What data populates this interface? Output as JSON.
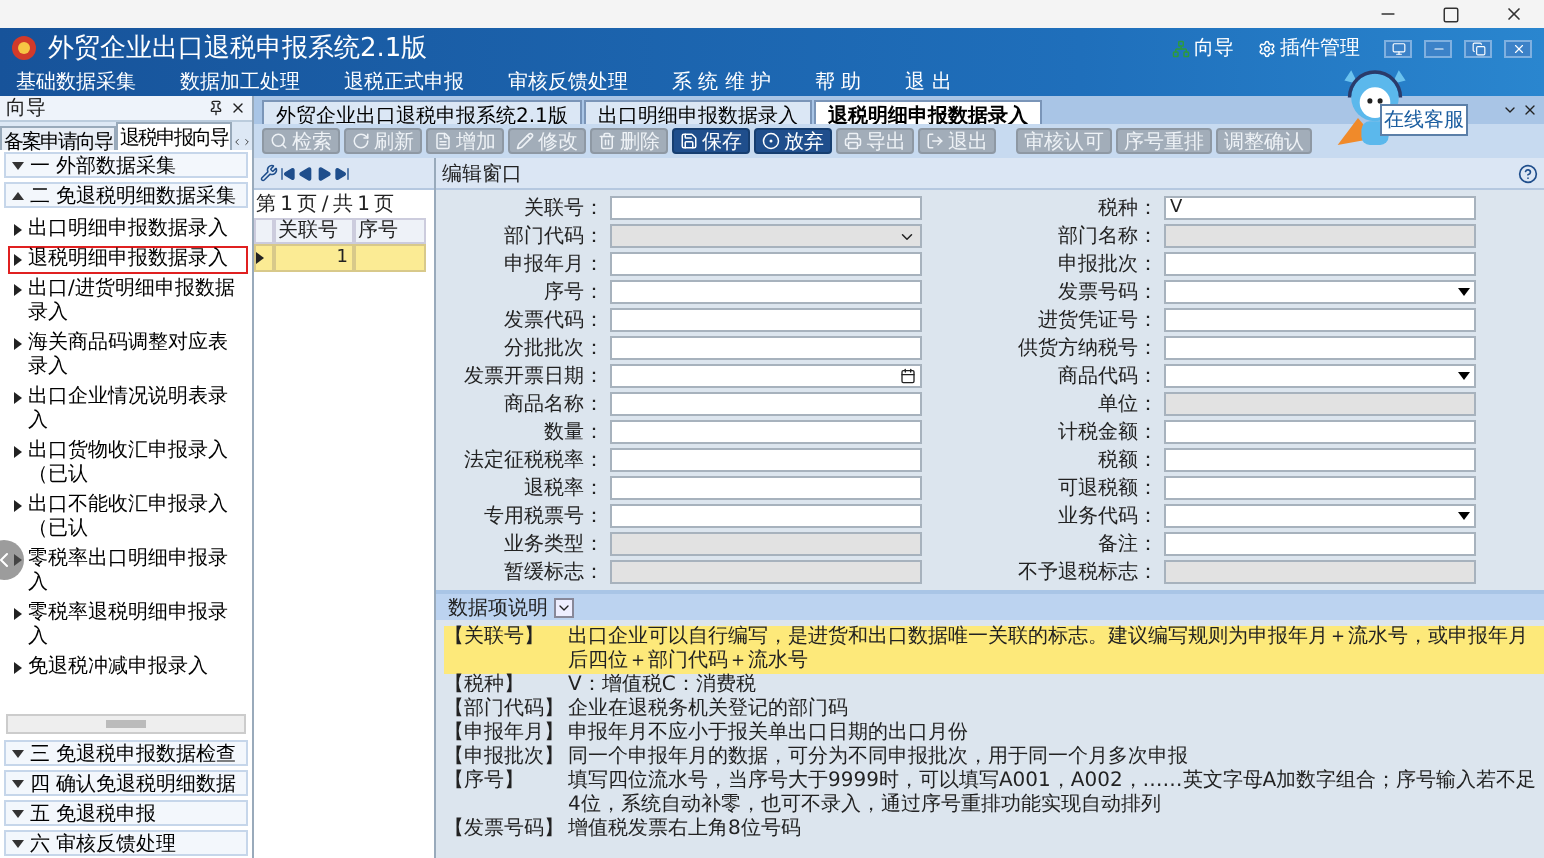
{
  "app": {
    "title": "外贸企业出口退税申报系统2.1版",
    "header_links": [
      "向导",
      "插件管理"
    ],
    "assistant_label": "在线客服"
  },
  "menu": [
    "基础数据采集",
    "数据加工处理",
    "退税正式申报",
    "审核反馈处理",
    "系 统 维 护",
    "帮 助",
    "退 出"
  ],
  "navigator": {
    "title": "向导",
    "tabs": [
      {
        "label": "备案申请向导",
        "selected": false
      },
      {
        "label": "退税申报向导",
        "selected": true
      }
    ],
    "sections": [
      {
        "label": "一 外部数据采集",
        "expanded": false
      },
      {
        "label": "二 免退税明细数据采集",
        "expanded": true,
        "items": [
          {
            "label": "出口明细申报数据录入",
            "selected": false
          },
          {
            "label": "退税明细申报数据录入",
            "selected": true
          },
          {
            "label": "出口/进货明细申报数据录入",
            "selected": false
          },
          {
            "label": "海关商品码调整对应表录入",
            "selected": false
          },
          {
            "label": "出口企业情况说明表录入",
            "selected": false
          },
          {
            "label": "出口货物收汇申报录入（已认",
            "selected": false
          },
          {
            "label": "出口不能收汇申报录入（已认",
            "selected": false
          },
          {
            "label": "零税率出口明细申报录入",
            "selected": false
          },
          {
            "label": "零税率退税明细申报录入",
            "selected": false
          },
          {
            "label": "免退税冲减申报录入",
            "selected": false
          }
        ]
      },
      {
        "label": "三 免退税申报数据检查",
        "expanded": false
      },
      {
        "label": "四 确认免退税明细数据",
        "expanded": false
      },
      {
        "label": "五 免退税申报",
        "expanded": false
      },
      {
        "label": "六 审核反馈处理",
        "expanded": false
      }
    ]
  },
  "tabs": [
    {
      "label": "外贸企业出口退税申报系统2.1版",
      "selected": false
    },
    {
      "label": "出口明细申报数据录入",
      "selected": false
    },
    {
      "label": "退税明细申报数据录入",
      "selected": true
    }
  ],
  "toolbar": [
    {
      "label": "检索",
      "kind": "search",
      "disabled": true
    },
    {
      "label": "刷新",
      "kind": "refresh",
      "disabled": true
    },
    {
      "label": "增加",
      "kind": "add",
      "disabled": true
    },
    {
      "label": "修改",
      "kind": "edit",
      "disabled": true
    },
    {
      "label": "删除",
      "kind": "delete",
      "disabled": true
    },
    {
      "label": "保存",
      "kind": "save",
      "disabled": false
    },
    {
      "label": "放弃",
      "kind": "discard",
      "disabled": false
    },
    {
      "label": "导出",
      "kind": "export",
      "disabled": true
    },
    {
      "label": "退出",
      "kind": "exit",
      "disabled": true
    },
    {
      "label": "审核认可",
      "kind": "plain",
      "disabled": true
    },
    {
      "label": "序号重排",
      "kind": "plain",
      "disabled": true
    },
    {
      "label": "调整确认",
      "kind": "plain",
      "disabled": true
    }
  ],
  "grid": {
    "pager": "第 1 页 / 共 1 页",
    "columns": [
      "关联号",
      "序号"
    ],
    "rows": [
      {
        "number": "1",
        "selected": true
      }
    ]
  },
  "editor": {
    "title": "编辑窗口",
    "fields": [
      {
        "label": "关联号：",
        "kind": "text",
        "disabled": false
      },
      {
        "label": "税种：",
        "kind": "text",
        "disabled": false,
        "value": "V"
      },
      {
        "label": "部门代码：",
        "kind": "select",
        "disabled": true
      },
      {
        "label": "部门名称：",
        "kind": "text",
        "disabled": true
      },
      {
        "label": "申报年月：",
        "kind": "text",
        "disabled": false
      },
      {
        "label": "申报批次：",
        "kind": "text",
        "disabled": false
      },
      {
        "label": "序号：",
        "kind": "text",
        "disabled": false
      },
      {
        "label": "发票号码：",
        "kind": "combo",
        "disabled": false
      },
      {
        "label": "发票代码：",
        "kind": "text",
        "disabled": false
      },
      {
        "label": "进货凭证号：",
        "kind": "text",
        "disabled": false
      },
      {
        "label": "分批批次：",
        "kind": "text",
        "disabled": false
      },
      {
        "label": "供货方纳税号：",
        "kind": "text",
        "disabled": false
      },
      {
        "label": "发票开票日期：",
        "kind": "date",
        "disabled": false
      },
      {
        "label": "商品代码：",
        "kind": "combo",
        "disabled": false
      },
      {
        "label": "商品名称：",
        "kind": "text",
        "disabled": false
      },
      {
        "label": "单位：",
        "kind": "text",
        "disabled": true
      },
      {
        "label": "数量：",
        "kind": "text",
        "disabled": false
      },
      {
        "label": "计税金额：",
        "kind": "text",
        "disabled": false
      },
      {
        "label": "法定征税税率：",
        "kind": "text",
        "disabled": false
      },
      {
        "label": "税额：",
        "kind": "text",
        "disabled": false
      },
      {
        "label": "退税率：",
        "kind": "text",
        "disabled": false
      },
      {
        "label": "可退税额：",
        "kind": "text",
        "disabled": false
      },
      {
        "label": "专用税票号：",
        "kind": "text",
        "disabled": false
      },
      {
        "label": "业务代码：",
        "kind": "combo",
        "disabled": false
      },
      {
        "label": "业务类型：",
        "kind": "text",
        "disabled": true
      },
      {
        "label": "备注：",
        "kind": "text",
        "disabled": false
      },
      {
        "label": "暂缓标志：",
        "kind": "text",
        "disabled": true
      },
      {
        "label": "不予退税标志：",
        "kind": "text",
        "disabled": true
      }
    ]
  },
  "help_panel": {
    "title": "数据项说明",
    "rows": [
      {
        "key": "【关联号】",
        "text": "出口企业可以自行编写，是进货和出口数据唯一关联的标志。建议编写规则为申报年月＋流水号，或申报年月后四位＋部门代码＋流水号",
        "selected": true
      },
      {
        "key": "【税种】",
        "text": "V：增值税C：消费税",
        "selected": false
      },
      {
        "key": "【部门代码】",
        "text": "企业在退税务机关登记的部门码",
        "selected": false
      },
      {
        "key": "【申报年月】",
        "text": "申报年月不应小于报关单出口日期的出口月份",
        "selected": false
      },
      {
        "key": "【申报批次】",
        "text": "同一个申报年月的数据，可分为不同申报批次，用于同一个月多次申报",
        "selected": false
      },
      {
        "key": "【序号】",
        "text": "填写四位流水号，当序号大于9999时，可以填写A001，A002，……英文字母A加数字组合；序号输入若不足4位，系统自动补零，也可不录入，通过序号重排功能实现自动排列",
        "selected": false
      },
      {
        "key": "【发票号码】",
        "text": "增值税发票右上角8位号码",
        "selected": false
      }
    ]
  }
}
